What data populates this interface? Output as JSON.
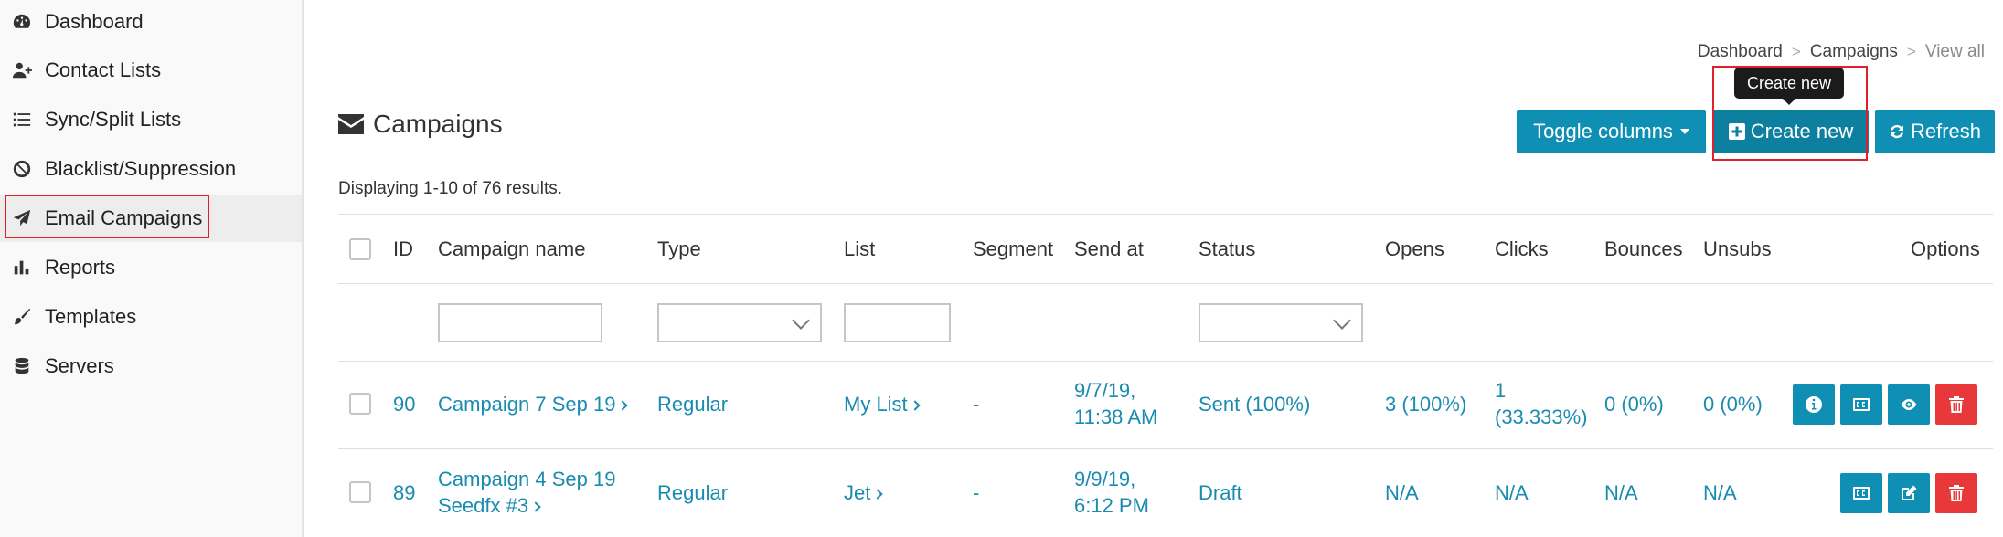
{
  "sidebar": {
    "items": [
      {
        "label": "Dashboard",
        "icon": "dashboard-icon"
      },
      {
        "label": "Contact Lists",
        "icon": "user-plus-icon"
      },
      {
        "label": "Sync/Split Lists",
        "icon": "list-icon"
      },
      {
        "label": "Blacklist/Suppression",
        "icon": "ban-icon"
      },
      {
        "label": "Email Campaigns",
        "icon": "paper-plane-icon"
      },
      {
        "label": "Reports",
        "icon": "bar-chart-icon"
      },
      {
        "label": "Templates",
        "icon": "brush-icon"
      },
      {
        "label": "Servers",
        "icon": "database-icon"
      }
    ],
    "active": "Email Campaigns"
  },
  "breadcrumb": {
    "home": "Dashboard",
    "section": "Campaigns",
    "current": "View all",
    "separator": ">"
  },
  "page": {
    "title": "Campaigns",
    "displaying": "Displaying 1-10 of 76 results."
  },
  "toolbar": {
    "toggle_columns": "Toggle columns",
    "create_new": "Create new",
    "refresh": "Refresh",
    "tooltip": "Create new"
  },
  "table": {
    "columns": [
      "ID",
      "Campaign name",
      "Type",
      "List",
      "Segment",
      "Send at",
      "Status",
      "Opens",
      "Clicks",
      "Bounces",
      "Unsubs",
      "Options"
    ],
    "rows": [
      {
        "id": "90",
        "name": "Campaign 7 Sep 19",
        "name2": "",
        "type": "Regular",
        "list": "My List",
        "segment": "-",
        "send_at_1": "9/7/19,",
        "send_at_2": "11:38 AM",
        "status": "Sent (100%)",
        "opens": "3 (100%)",
        "clicks_1": "1",
        "clicks_2": "(33.333%)",
        "bounces": "0 (0%)",
        "unsubs": "0 (0%)"
      },
      {
        "id": "89",
        "name": "Campaign 4 Sep 19",
        "name2": "Seedfx #3",
        "type": "Regular",
        "list": "Jet",
        "segment": "-",
        "send_at_1": "9/9/19,",
        "send_at_2": "6:12 PM",
        "status": "Draft",
        "opens": "N/A",
        "clicks_1": "N/A",
        "clicks_2": "",
        "bounces": "N/A",
        "unsubs": "N/A"
      }
    ]
  },
  "colors": {
    "accent": "#0f8fb3",
    "danger": "#e8383a",
    "highlight": "#e0202a"
  }
}
